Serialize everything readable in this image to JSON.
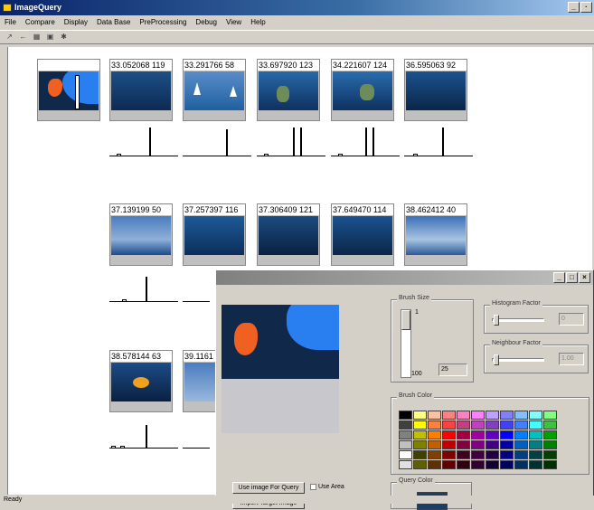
{
  "window": {
    "title": "ImageQuery",
    "min": "_",
    "max": "·"
  },
  "menu": [
    "File",
    "Compare",
    "Display",
    "Data Base",
    "PreProcessing",
    "Debug",
    "View",
    "Help"
  ],
  "toolbar": [
    "↗",
    "←",
    "▦",
    "▣",
    "✱"
  ],
  "status": "Ready",
  "results": [
    {
      "score": "",
      "img": "query"
    },
    {
      "score": "33.052068 119",
      "img": "deep"
    },
    {
      "score": "33.291766 58",
      "img": "sail"
    },
    {
      "score": "33.697920 123",
      "img": "diver"
    },
    {
      "score": "34.221607 124",
      "img": "diver"
    },
    {
      "score": "36.595063 92",
      "img": "deep"
    },
    {
      "score": "37.139199 50",
      "img": "clouds"
    },
    {
      "score": "37.257397 116",
      "img": "rays"
    },
    {
      "score": "37.306409 121",
      "img": "reef"
    },
    {
      "score": "37.649470 114",
      "img": "deep"
    },
    {
      "score": "38.462412 40",
      "img": "clouds"
    },
    {
      "score": "38.578144 63",
      "img": "fish"
    },
    {
      "score": "39.1161",
      "img": "clouds"
    }
  ],
  "dialog": {
    "min": "_",
    "max": "□",
    "close": "×",
    "brush_size_label": "Brush Size",
    "brush_max": "1",
    "brush_min": "100",
    "brush_value": "25",
    "hist_factor_label": "Histogram Factor",
    "hist_factor_value": "0",
    "neighbour_factor_label": "Neighbour Factor",
    "neighbour_factor_value": "1.00",
    "brush_color_label": "Brush Color",
    "query_color_label": "Query Color",
    "use_image_button": "Use image For Query",
    "use_area_label": "Use Area",
    "import_button": "Import Target Image"
  },
  "colors": {
    "palette": [
      "#000000",
      "#ffff80",
      "#ffc0a0",
      "#ff8080",
      "#ff80c0",
      "#ff80ff",
      "#c0a0ff",
      "#8080ff",
      "#80c0ff",
      "#80ffff",
      "#80ff80",
      "#404040",
      "#ffff00",
      "#ff8040",
      "#ff4040",
      "#c04080",
      "#c040c0",
      "#8040c0",
      "#4040ff",
      "#4080ff",
      "#40ffff",
      "#40c040",
      "#808080",
      "#c0c000",
      "#ff8000",
      "#ff0000",
      "#a00040",
      "#a000a0",
      "#6000c0",
      "#0000ff",
      "#0080ff",
      "#00c0c0",
      "#00a000",
      "#c0c0c0",
      "#808000",
      "#c06000",
      "#c00000",
      "#800040",
      "#800080",
      "#400080",
      "#0000a0",
      "#0060c0",
      "#008080",
      "#008000",
      "#ffffff",
      "#404000",
      "#804000",
      "#800000",
      "#400020",
      "#400040",
      "#200040",
      "#000080",
      "#004080",
      "#004040",
      "#004000",
      "#e0e0e0",
      "#606000",
      "#603000",
      "#600000",
      "#300010",
      "#300030",
      "#100030",
      "#000060",
      "#003060",
      "#003030",
      "#003000"
    ],
    "query_color": "#1b3d66"
  }
}
